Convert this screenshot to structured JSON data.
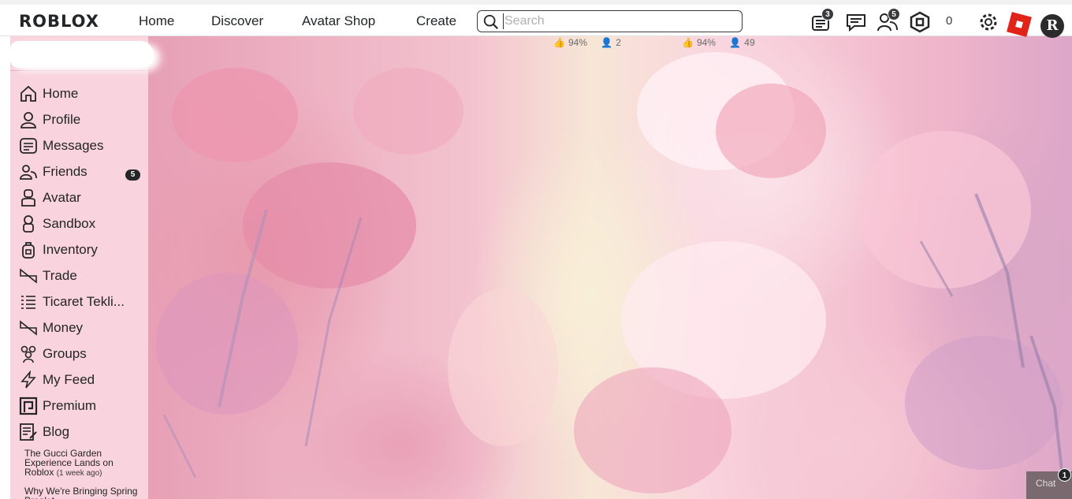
{
  "app": {
    "logo": "ROBLOX"
  },
  "nav": {
    "links": [
      "Home",
      "Discover",
      "Avatar Shop",
      "Create"
    ],
    "search_placeholder": "Search"
  },
  "header_icons": {
    "notifications_badge": "3",
    "friends_badge": "5",
    "robux_count": "0",
    "avatar_letter": "R"
  },
  "stats": [
    {
      "rating": "94%",
      "players": "2"
    },
    {
      "rating": "94%",
      "players": "49"
    }
  ],
  "sidebar": {
    "items": [
      {
        "label": "Home",
        "icon": "home-icon"
      },
      {
        "label": "Profile",
        "icon": "profile-icon"
      },
      {
        "label": "Messages",
        "icon": "messages-icon"
      },
      {
        "label": "Friends",
        "icon": "friends-icon",
        "badge": "5"
      },
      {
        "label": "Avatar",
        "icon": "avatar-icon"
      },
      {
        "label": "Sandbox",
        "icon": "sandbox-icon"
      },
      {
        "label": "Inventory",
        "icon": "inventory-icon"
      },
      {
        "label": "Trade",
        "icon": "trade-icon"
      },
      {
        "label": "Ticaret Tekli...",
        "icon": "list-icon"
      },
      {
        "label": "Money",
        "icon": "money-icon"
      },
      {
        "label": "Groups",
        "icon": "groups-icon"
      },
      {
        "label": "My Feed",
        "icon": "feed-icon"
      },
      {
        "label": "Premium",
        "icon": "premium-icon"
      },
      {
        "label": "Blog",
        "icon": "blog-icon"
      }
    ],
    "blog_posts": [
      {
        "title": "The Gucci Garden Experience Lands on Roblox",
        "ago": "(1 week ago)"
      },
      {
        "title": "Why We're Bringing Spring Break t...",
        "ago": ""
      }
    ]
  },
  "chat": {
    "label": "Chat",
    "badge": "1"
  }
}
